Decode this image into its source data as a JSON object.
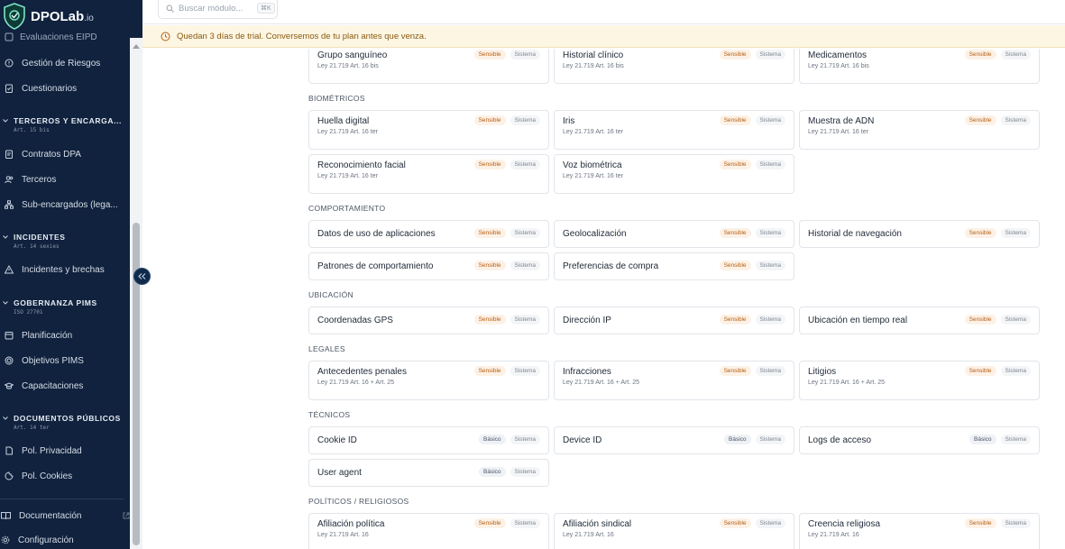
{
  "app": {
    "logo_text": "DPOLab",
    "logo_suffix": ".io"
  },
  "sidebar": {
    "cut_item": "Evaluaciones EIPD",
    "items_top": [
      {
        "label": "Gestión de Riesgos",
        "icon": "alert-circle-icon"
      },
      {
        "label": "Cuestionarios",
        "icon": "clipboard-check-icon"
      }
    ],
    "sections": [
      {
        "title": "TERCEROS Y ENCARGA...",
        "sub": "Art. 15 bis",
        "items": [
          {
            "label": "Contratos DPA",
            "icon": "file-edit-icon"
          },
          {
            "label": "Terceros",
            "icon": "users-icon"
          },
          {
            "label": "Sub-encargados (lega...",
            "icon": "network-icon"
          }
        ]
      },
      {
        "title": "INCIDENTES",
        "sub": "Art. 14 sexies",
        "items": [
          {
            "label": "Incidentes y brechas",
            "icon": "warning-triangle-icon"
          }
        ]
      },
      {
        "title": "GOBERNANZA PIMS",
        "sub": "ISO 27701",
        "items": [
          {
            "label": "Planificación",
            "icon": "calendar-grid-icon"
          },
          {
            "label": "Objetivos PIMS",
            "icon": "target-icon"
          },
          {
            "label": "Capacitaciones",
            "icon": "graduation-cap-icon"
          }
        ]
      },
      {
        "title": "DOCUMENTOS PÚBLICOS",
        "sub": "Art. 14 ter",
        "items": [
          {
            "label": "Pol. Privacidad",
            "icon": "document-icon"
          },
          {
            "label": "Pol. Cookies",
            "icon": "cookie-icon"
          }
        ]
      }
    ],
    "footer": [
      {
        "label": "Documentación",
        "icon": "book-icon"
      },
      {
        "label": "Configuración",
        "icon": "gear-icon"
      }
    ]
  },
  "search": {
    "placeholder": "Buscar módulo...",
    "shortcut": "⌘K"
  },
  "trial_banner": "Quedan 3 días de trial. Conversemos de tu plan antes que venza.",
  "badges": {
    "sensible": "Sensible",
    "basico": "Básico",
    "sistema": "Sistema"
  },
  "groups": [
    {
      "title": "",
      "items": [
        {
          "name": "Grupo sanguíneo",
          "law": "Ley 21.719 Art. 16 bis",
          "level": "Sensible"
        },
        {
          "name": "Historial clínico",
          "law": "Ley 21.719 Art. 16 bis",
          "level": "Sensible"
        },
        {
          "name": "Medicamentos",
          "law": "Ley 21.719 Art. 16 bis",
          "level": "Sensible"
        }
      ]
    },
    {
      "title": "BIOMÉTRICOS",
      "items": [
        {
          "name": "Huella digital",
          "law": "Ley 21.719 Art. 16 ter",
          "level": "Sensible"
        },
        {
          "name": "Iris",
          "law": "Ley 21.719 Art. 16 ter",
          "level": "Sensible"
        },
        {
          "name": "Muestra de ADN",
          "law": "Ley 21.719 Art. 16 ter",
          "level": "Sensible"
        },
        {
          "name": "Reconocimiento facial",
          "law": "Ley 21.719 Art. 16 ter",
          "level": "Sensible"
        },
        {
          "name": "Voz biométrica",
          "law": "Ley 21.719 Art. 16 ter",
          "level": "Sensible"
        }
      ]
    },
    {
      "title": "COMPORTAMIENTO",
      "items": [
        {
          "name": "Datos de uso de aplicaciones",
          "law": "",
          "level": "Sensible"
        },
        {
          "name": "Geolocalización",
          "law": "",
          "level": "Sensible"
        },
        {
          "name": "Historial de navegación",
          "law": "",
          "level": "Sensible"
        },
        {
          "name": "Patrones de comportamiento",
          "law": "",
          "level": "Sensible"
        },
        {
          "name": "Preferencias de compra",
          "law": "",
          "level": "Sensible"
        }
      ]
    },
    {
      "title": "UBICACIÓN",
      "items": [
        {
          "name": "Coordenadas GPS",
          "law": "",
          "level": "Sensible"
        },
        {
          "name": "Dirección IP",
          "law": "",
          "level": "Sensible"
        },
        {
          "name": "Ubicación en tiempo real",
          "law": "",
          "level": "Sensible"
        }
      ]
    },
    {
      "title": "LEGALES",
      "items": [
        {
          "name": "Antecedentes penales",
          "law": "Ley 21.719 Art. 16 + Art. 25",
          "level": "Sensible"
        },
        {
          "name": "Infracciones",
          "law": "Ley 21.719 Art. 16 + Art. 25",
          "level": "Sensible"
        },
        {
          "name": "Litigios",
          "law": "Ley 21.719 Art. 16 + Art. 25",
          "level": "Sensible"
        }
      ]
    },
    {
      "title": "TÉCNICOS",
      "items": [
        {
          "name": "Cookie ID",
          "law": "",
          "level": "Básico"
        },
        {
          "name": "Device ID",
          "law": "",
          "level": "Básico"
        },
        {
          "name": "Logs de acceso",
          "law": "",
          "level": "Básico"
        },
        {
          "name": "User agent",
          "law": "",
          "level": "Básico"
        }
      ]
    },
    {
      "title": "POLÍTICOS / RELIGIOSOS",
      "items": [
        {
          "name": "Afiliación política",
          "law": "Ley 21.719 Art. 16",
          "level": "Sensible"
        },
        {
          "name": "Afiliación sindical",
          "law": "Ley 21.719 Art. 16",
          "level": "Sensible"
        },
        {
          "name": "Creencia religiosa",
          "law": "Ley 21.719 Art. 16",
          "level": "Sensible"
        }
      ]
    }
  ],
  "colors": {
    "sidebar_bg": "#10223d",
    "accent_sensitive": "#b45f12",
    "trial_bg": "#fdf6e3"
  }
}
